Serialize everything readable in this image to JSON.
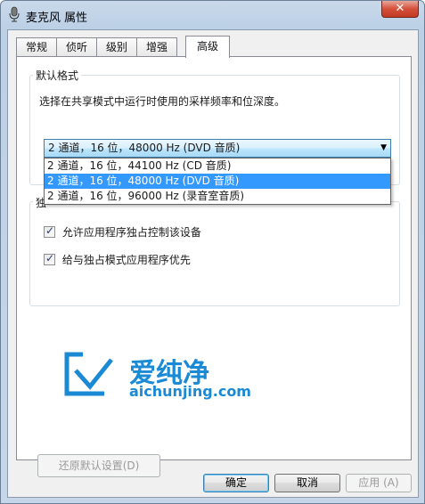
{
  "window": {
    "title": "麦克风 属性",
    "close_glyph": "✕"
  },
  "tabs": [
    {
      "label": "常规"
    },
    {
      "label": "侦听"
    },
    {
      "label": "级别"
    },
    {
      "label": "增强"
    },
    {
      "label": "高级",
      "active": true
    }
  ],
  "default_format": {
    "group_title": "默认格式",
    "description": "选择在共享模式中运行时使用的采样频率和位深度。",
    "selected": "2 通道，16 位，48000 Hz (DVD 音质)",
    "options": [
      "2 通道，16 位，44100 Hz (CD 音质)",
      "2 通道，16 位，48000 Hz (DVD 音质)",
      "2 通道，16 位，96000 Hz (录音室音质)"
    ],
    "highlighted_index": 1
  },
  "exclusive": {
    "group_title_visible": "独",
    "options": [
      {
        "label": "允许应用程序独占控制该设备",
        "checked": true
      },
      {
        "label": "给与独占模式应用程序优先",
        "checked": true
      }
    ]
  },
  "watermark": {
    "name": "爱纯净",
    "url": "aichunjing.com",
    "color": "#1a8ad4"
  },
  "buttons": {
    "restore": "还原默认设置(D)",
    "ok": "确定",
    "cancel": "取消",
    "apply": "应用 (A)"
  },
  "colors": {
    "selection": "#3399ff",
    "accent_border": "#3c7fb1"
  }
}
